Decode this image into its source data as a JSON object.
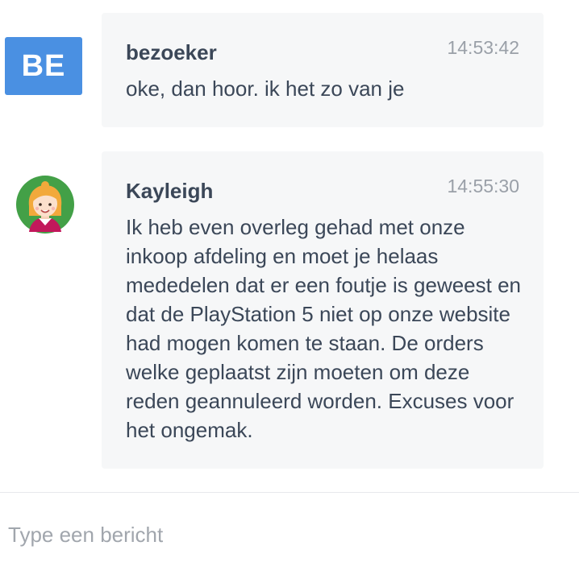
{
  "messages": [
    {
      "avatar_initials": "BE",
      "sender": "bezoeker",
      "time": "14:53:42",
      "text": "oke, dan hoor. ik het zo van je"
    },
    {
      "avatar_icon": "agent-avatar-icon",
      "sender": "Kayleigh",
      "time": "14:55:30",
      "text": "Ik heb even overleg gehad met onze inkoop afdeling en moet je helaas mededelen dat er een foutje is geweest en dat de PlayStation 5 niet op onze website had mogen komen te staan. De orders welke geplaatst zijn moeten om deze reden geannuleerd worden. Excuses voor het ongemak."
    }
  ],
  "composer": {
    "placeholder": "Type een bericht",
    "value": ""
  },
  "colors": {
    "visitor_avatar_bg": "#4a90e2",
    "bubble_bg": "#f6f7f8",
    "agent_avatar_bg": "#43a047"
  }
}
